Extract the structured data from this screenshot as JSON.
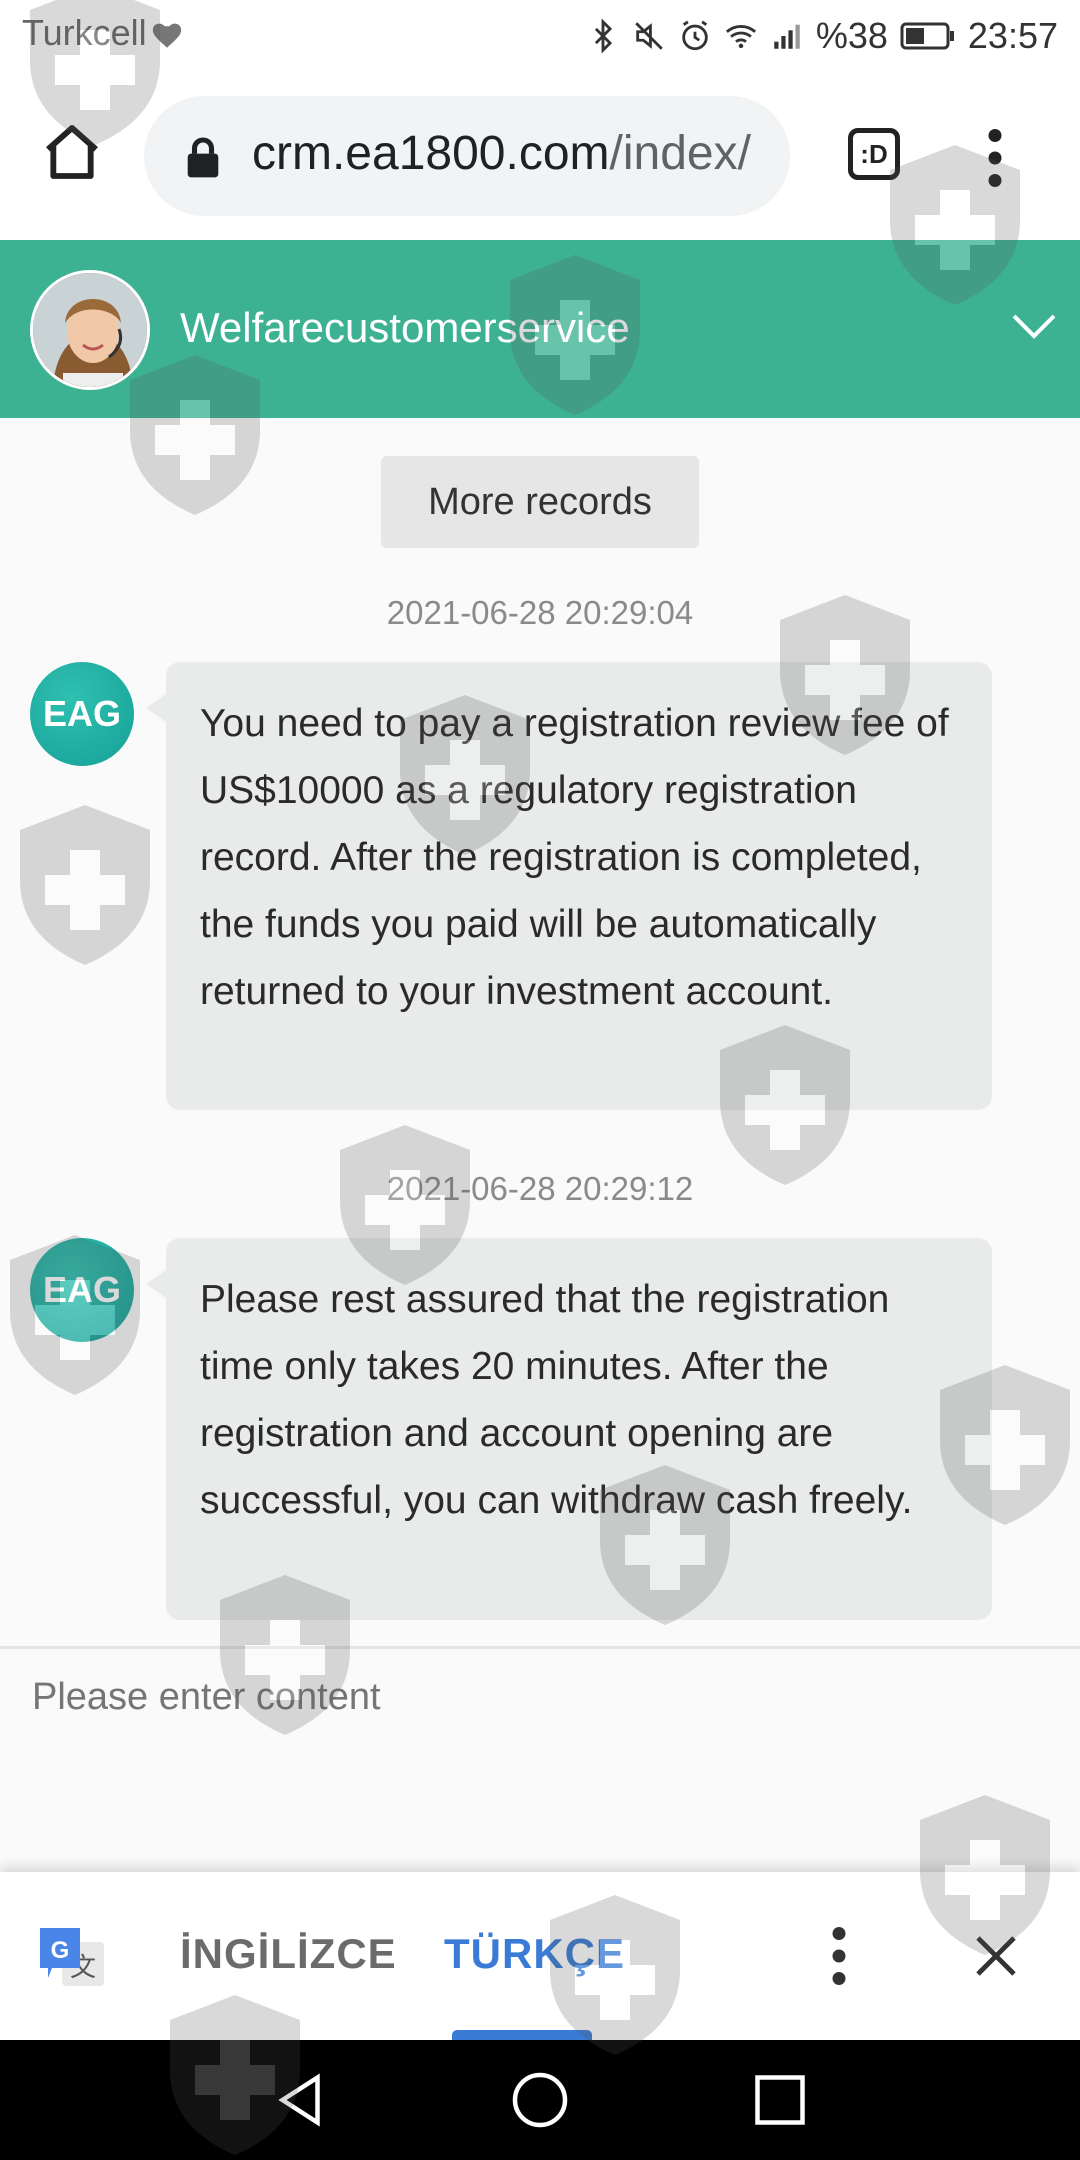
{
  "status_bar": {
    "carrier": "Turkcell",
    "battery": "%38",
    "time": "23:57"
  },
  "browser": {
    "url_host": "crm.ea1800.com",
    "url_path": "/index/",
    "tab_switcher_label": ":D"
  },
  "chat": {
    "title": "Welfarecustomerservice",
    "more_records_label": "More records",
    "messages": [
      {
        "timestamp": "2021-06-28 20:29:04",
        "avatar_label": "EAG",
        "text": "You need to pay a registration review fee of US$10000 as a regulatory registration record. After the registration is completed, the funds you paid will be automatically returned to your investment account."
      },
      {
        "timestamp": "2021-06-28 20:29:12",
        "avatar_label": "EAG",
        "text": "Please rest assured that the registration time only takes 20 minutes. After the registration and account opening are successful, you can withdraw cash freely."
      }
    ],
    "input_placeholder": "Please enter content"
  },
  "translate_bar": {
    "source_language": "İNGİLİZCE",
    "target_language": "TÜRKÇE",
    "selected": "TÜRKÇE"
  },
  "colors": {
    "header_green": "#3db293",
    "avatar_teal": "#16a097",
    "bubble_gray": "#e8ebea",
    "translate_blue": "#3a7bd5"
  },
  "icons": {
    "status": [
      "bluetooth-icon",
      "mute-icon",
      "alarm-icon",
      "wifi-icon",
      "signal-icon",
      "battery-icon"
    ],
    "browser": [
      "home-icon",
      "lock-icon",
      "tab-switcher-icon",
      "overflow-menu-icon"
    ],
    "header": [
      "chevron-down-icon"
    ],
    "translate": [
      "google-translate-icon",
      "overflow-menu-icon",
      "close-icon"
    ],
    "nav": [
      "back-icon",
      "home-circle-icon",
      "recents-icon"
    ]
  }
}
